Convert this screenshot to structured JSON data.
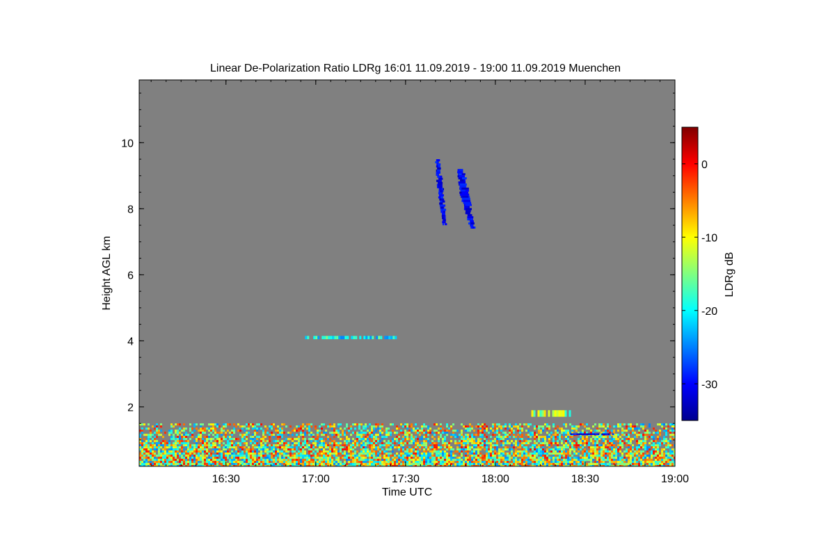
{
  "chart_data": {
    "type": "heatmap",
    "title": "Linear De-Polarization Ratio LDRg   16:01 11.09.2019 - 19:00 11.09.2019 Muenchen",
    "xlabel": "Time UTC",
    "ylabel": "Height AGL km",
    "xlim": [
      "16:01",
      "19:00"
    ],
    "ylim": [
      0.2,
      11.9
    ],
    "x_ticks": [
      "16:30",
      "17:00",
      "17:30",
      "18:00",
      "18:30",
      "19:00"
    ],
    "y_ticks": [
      2,
      4,
      6,
      8,
      10
    ],
    "background_color": "#808080",
    "colorbar": {
      "label": "LDRg dB",
      "range": [
        -35,
        5
      ],
      "ticks": [
        0,
        -10,
        -20,
        -30
      ],
      "colormap": "jet"
    },
    "features": [
      {
        "name": "low-level clutter",
        "time_start": "16:01",
        "time_end": "19:00",
        "height_start": 0.2,
        "height_end": 1.5,
        "ldr_min": -25,
        "ldr_max": 0
      },
      {
        "name": "ice cloud streak",
        "time_start": "17:40",
        "time_end": "17:44",
        "height_start": 7.5,
        "height_end": 9.5,
        "ldr_min": -33,
        "ldr_max": -28
      },
      {
        "name": "ice cloud streak",
        "time_start": "17:47",
        "time_end": "17:54",
        "height_start": 7.4,
        "height_end": 9.2,
        "ldr_min": -33,
        "ldr_max": -28
      },
      {
        "name": "thin layer",
        "time_start": "16:55",
        "time_end": "17:27",
        "height_start": 4.05,
        "height_end": 4.15,
        "ldr_min": -25,
        "ldr_max": -15
      },
      {
        "name": "scattered echoes",
        "time_start": "18:12",
        "time_end": "18:25",
        "height_start": 1.7,
        "height_end": 1.9,
        "ldr_min": -20,
        "ldr_max": -8
      },
      {
        "name": "thin layer",
        "time_start": "18:25",
        "time_end": "18:39",
        "height_start": 1.15,
        "height_end": 1.2,
        "ldr_min": -33,
        "ldr_max": -28
      }
    ]
  }
}
